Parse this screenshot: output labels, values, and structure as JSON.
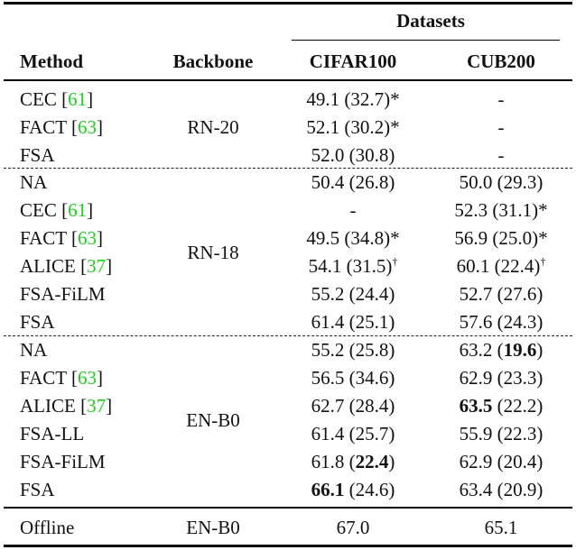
{
  "table": {
    "group_header": "Datasets",
    "columns": [
      "Method",
      "Backbone",
      "CIFAR100",
      "CUB200"
    ],
    "citation_color": "#19d219",
    "sections": [
      {
        "backbone": "RN-20",
        "rows": [
          {
            "method": "CEC",
            "cite": "61",
            "cifar": "49.1 (32.7)*",
            "cub": "-"
          },
          {
            "method": "FACT",
            "cite": "63",
            "cifar": "52.1 (30.2)*",
            "cub": "-"
          },
          {
            "method": "FSA",
            "cite": "",
            "cifar": "52.0 (30.8)",
            "cub": "-"
          }
        ]
      },
      {
        "backbone": "RN-18",
        "rows": [
          {
            "method": "NA",
            "cite": "",
            "cifar": "50.4 (26.8)",
            "cub": "50.0 (29.3)"
          },
          {
            "method": "CEC",
            "cite": "61",
            "cifar": "-",
            "cub": "52.3 (31.1)*"
          },
          {
            "method": "FACT",
            "cite": "63",
            "cifar": "49.5 (34.8)*",
            "cub": "56.9 (25.0)*"
          },
          {
            "method": "ALICE",
            "cite": "37",
            "cifar": "54.1 (31.5)†",
            "cub": "60.1 (22.4)†"
          },
          {
            "method": "FSA-FiLM",
            "cite": "",
            "cifar": "55.2 (24.4)",
            "cub": "52.7 (27.6)"
          },
          {
            "method": "FSA",
            "cite": "",
            "cifar": "61.4 (25.1)",
            "cub": "57.6 (24.3)"
          }
        ]
      },
      {
        "backbone": "EN-B0",
        "rows": [
          {
            "method": "NA",
            "cite": "",
            "cifar": "55.2 (25.8)",
            "cub": "63.2 (19.6)",
            "bold": {
              "cub_paren": true
            }
          },
          {
            "method": "FACT",
            "cite": "63",
            "cifar": "56.5 (34.6)",
            "cub": "62.9 (23.3)"
          },
          {
            "method": "ALICE",
            "cite": "37",
            "cifar": "62.7 (28.4)",
            "cub": "63.5 (22.2)",
            "bold": {
              "cub_main": true
            }
          },
          {
            "method": "FSA-LL",
            "cite": "",
            "cifar": "61.4 (25.7)",
            "cub": "55.9 (22.3)"
          },
          {
            "method": "FSA-FiLM",
            "cite": "",
            "cifar": "61.8 (22.4)",
            "cub": "62.9 (20.4)",
            "bold": {
              "cifar_paren": true
            }
          },
          {
            "method": "FSA",
            "cite": "",
            "cifar": "66.1 (24.6)",
            "cub": "63.4 (20.9)",
            "bold": {
              "cifar_main": true
            }
          }
        ]
      }
    ],
    "offline": {
      "method": "Offline",
      "backbone": "EN-B0",
      "cifar": "67.0",
      "cub": "65.1"
    }
  }
}
